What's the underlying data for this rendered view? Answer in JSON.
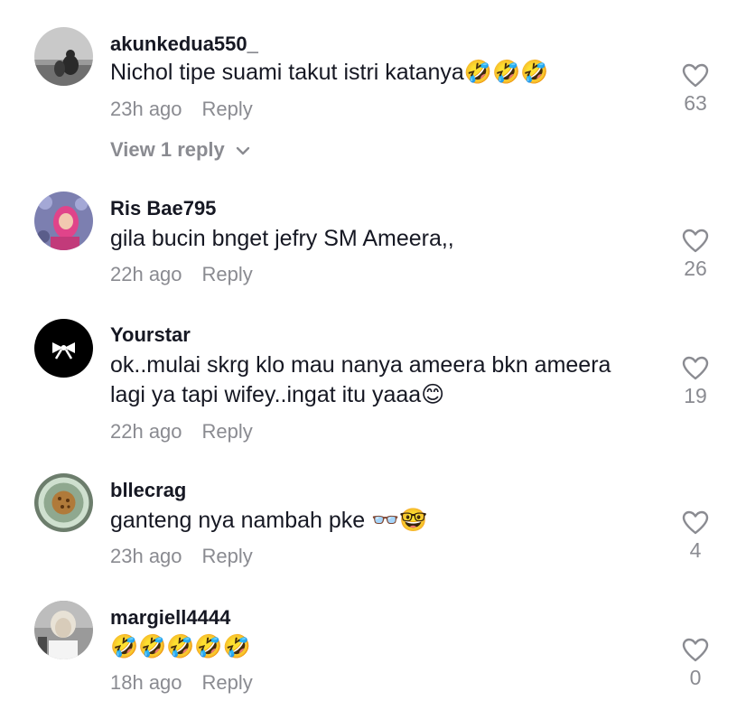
{
  "comments": [
    {
      "username": "akunkedua550_",
      "text": "Nichol tipe suami takut istri katanya🤣🤣🤣",
      "time": "23h ago",
      "reply_label": "Reply",
      "likes": "63",
      "view_replies": "View 1 reply"
    },
    {
      "username": "Ris Bae795",
      "text": "gila bucin bnget jefry SM Ameera,,",
      "time": "22h ago",
      "reply_label": "Reply",
      "likes": "26"
    },
    {
      "username": "Yourstar",
      "text": "ok..mulai skrg klo mau nanya ameera bkn ameera lagi ya tapi wifey..ingat itu yaaa😊",
      "time": "22h ago",
      "reply_label": "Reply",
      "likes": "19"
    },
    {
      "username": "bllecrag",
      "text": "ganteng nya nambah pke 👓🤓",
      "time": "23h ago",
      "reply_label": "Reply",
      "likes": "4"
    },
    {
      "username": "margiell4444",
      "text": "🤣🤣🤣🤣🤣",
      "time": "18h ago",
      "reply_label": "Reply",
      "likes": "0"
    }
  ],
  "colors": {
    "primary_text": "#161823",
    "secondary_text": "#8a8b91"
  },
  "icons": {
    "like": "heart-outline-icon",
    "expand": "chevron-down-icon"
  }
}
